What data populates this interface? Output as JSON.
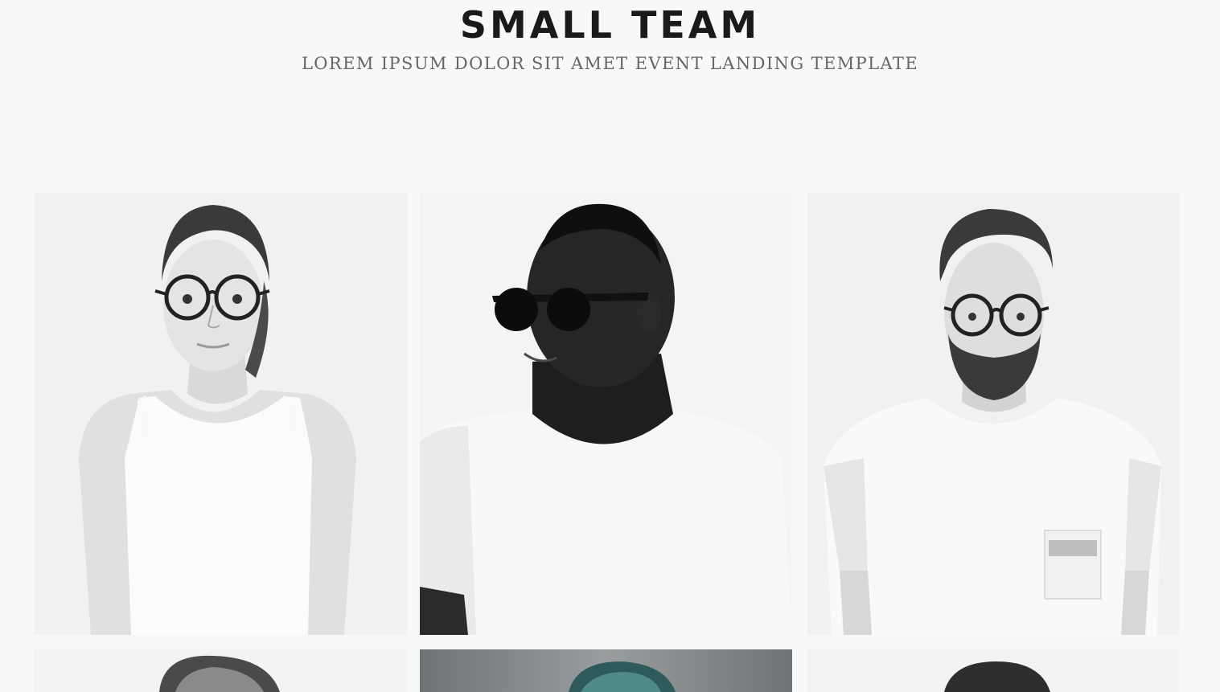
{
  "section": {
    "title": "SMALL TEAM",
    "subtitle": "LOREM IPSUM DOLOR SIT AMET EVENT LANDING TEMPLATE"
  },
  "team": {
    "members": [
      {
        "photo": "portrait-woman-glasses-tank-top"
      },
      {
        "photo": "portrait-man-sunglasses-tshirt"
      },
      {
        "photo": "portrait-man-beard-glasses-tshirt"
      },
      {
        "photo": "portrait-partial-top-hair"
      },
      {
        "photo": "portrait-partial-teal-hair-dark-bg"
      },
      {
        "photo": "portrait-partial-dark-hair"
      }
    ]
  },
  "colors": {
    "background": "#f7f8f8",
    "title": "#1a1a1a",
    "subtitle": "#666666"
  }
}
